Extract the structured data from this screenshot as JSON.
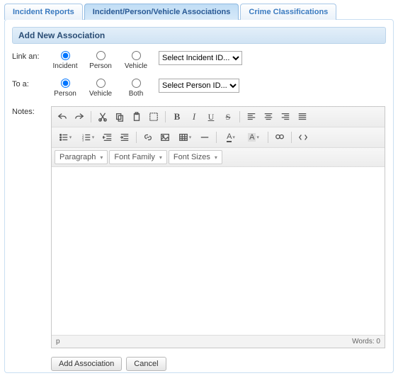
{
  "tabs": [
    {
      "label": "Incident Reports",
      "active": false
    },
    {
      "label": "Incident/Person/Vehicle Associations",
      "active": true
    },
    {
      "label": "Crime Classifications",
      "active": false
    }
  ],
  "section": {
    "title": "Add New Association"
  },
  "form": {
    "link_label": "Link an:",
    "link_radios": [
      "Incident",
      "Person",
      "Vehicle"
    ],
    "link_selected": 0,
    "link_select_placeholder": "Select Incident ID...",
    "to_label": "To a:",
    "to_radios": [
      "Person",
      "Vehicle",
      "Both"
    ],
    "to_selected": 0,
    "to_select_placeholder": "Select Person ID...",
    "notes_label": "Notes:"
  },
  "editor": {
    "row3": {
      "paragraph": "Paragraph",
      "font_family": "Font Family",
      "font_sizes": "Font Sizes"
    },
    "status_path": "p",
    "status_words": "Words: 0"
  },
  "actions": {
    "add": "Add Association",
    "cancel": "Cancel"
  }
}
